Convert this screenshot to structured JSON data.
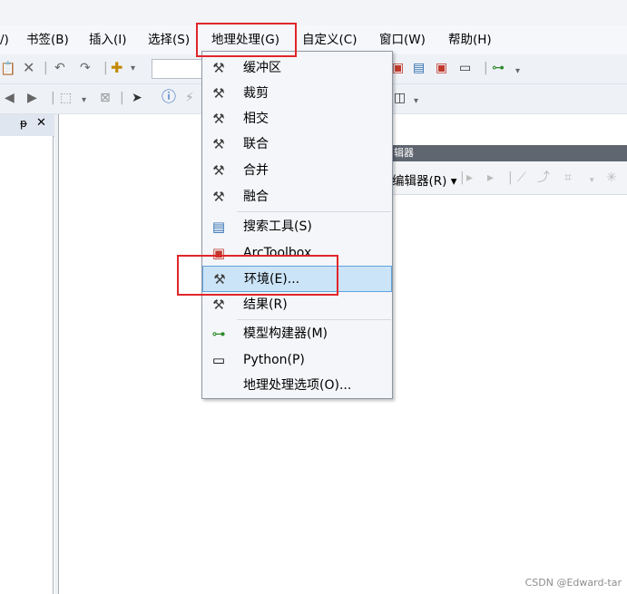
{
  "menubar": {
    "items": [
      {
        "label": "/)",
        "name": "menu-partial-left"
      },
      {
        "label": "书签(B)",
        "name": "menu-bookmarks"
      },
      {
        "label": "插入(I)",
        "name": "menu-insert"
      },
      {
        "label": "选择(S)",
        "name": "menu-select"
      },
      {
        "label": "地理处理(G)",
        "name": "menu-geoprocessing"
      },
      {
        "label": "自定义(C)",
        "name": "menu-customize"
      },
      {
        "label": "窗口(W)",
        "name": "menu-windows"
      },
      {
        "label": "帮助(H)",
        "name": "menu-help"
      }
    ]
  },
  "left_pane": {
    "pin_glyph": "ᵽ",
    "close_glyph": "✕"
  },
  "editor_toolbar": {
    "title": "辑器",
    "dropdown_label": "编辑器(R) ▾"
  },
  "geoprocessing_menu": {
    "items": [
      {
        "label": "缓冲区",
        "icon": "hammer-icon"
      },
      {
        "label": "裁剪",
        "icon": "hammer-icon"
      },
      {
        "label": "相交",
        "icon": "hammer-icon"
      },
      {
        "label": "联合",
        "icon": "hammer-icon"
      },
      {
        "label": "合并",
        "icon": "hammer-icon"
      },
      {
        "label": "融合",
        "icon": "hammer-icon"
      },
      {
        "label": "搜索工具(S)",
        "icon": "search-window-icon"
      },
      {
        "label": "ArcToolbox",
        "icon": "toolbox-icon"
      },
      {
        "label": "环境(E)...",
        "icon": "environment-tools-icon"
      },
      {
        "label": "结果(R)",
        "icon": "results-icon"
      },
      {
        "label": "模型构建器(M)",
        "icon": "model-builder-icon"
      },
      {
        "label": "Python(P)",
        "icon": "python-window-icon"
      },
      {
        "label": "地理处理选项(O)...",
        "icon": ""
      }
    ],
    "highlighted_index": 8
  },
  "annotation_color": "#e0262a",
  "highlight_color": "#cce4f7",
  "watermark": "CSDN @Edward-tar"
}
